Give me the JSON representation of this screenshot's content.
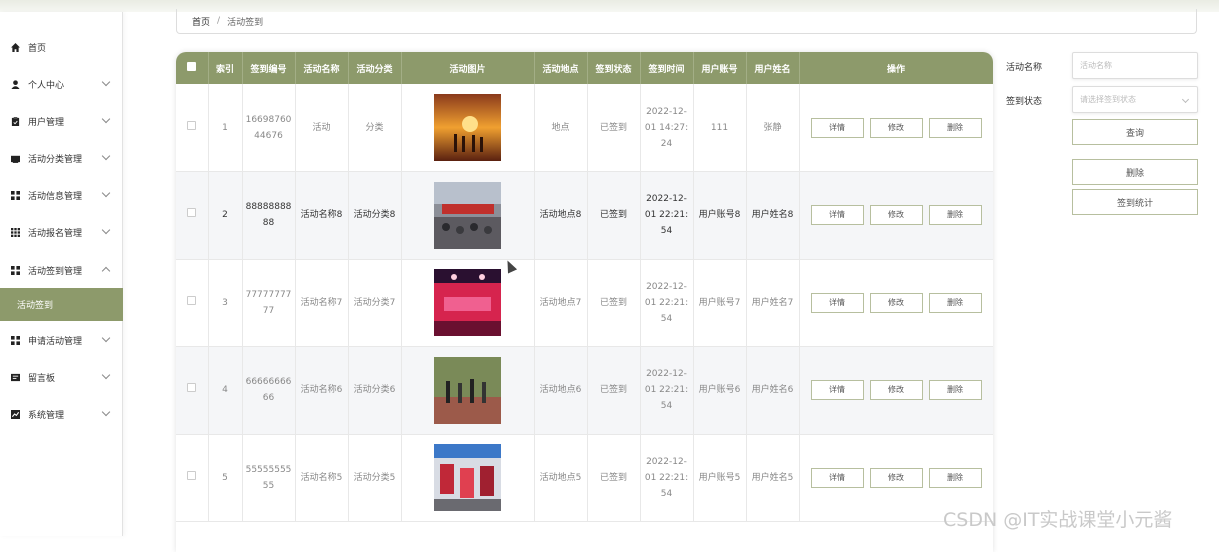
{
  "sidebar": {
    "items": [
      {
        "label": "首页",
        "icon": "home-icon"
      },
      {
        "label": "个人中心",
        "icon": "user-icon"
      },
      {
        "label": "用户管理",
        "icon": "clipboard-icon"
      },
      {
        "label": "活动分类管理",
        "icon": "folder-icon"
      },
      {
        "label": "活动信息管理",
        "icon": "grid-icon"
      },
      {
        "label": "活动报名管理",
        "icon": "grid9-icon"
      },
      {
        "label": "活动签到管理",
        "icon": "grid-icon"
      },
      {
        "label": "活动签到",
        "icon": ""
      },
      {
        "label": "申请活动管理",
        "icon": "grid-icon"
      },
      {
        "label": "留言板",
        "icon": "message-icon"
      },
      {
        "label": "系统管理",
        "icon": "chart-icon"
      }
    ]
  },
  "breadcrumb": {
    "home": "首页",
    "sep": "/",
    "current": "活动签到"
  },
  "table": {
    "headers": [
      "索引",
      "签到编号",
      "活动名称",
      "活动分类",
      "活动图片",
      "活动地点",
      "签到状态",
      "签到时间",
      "用户账号",
      "用户姓名",
      "操作"
    ],
    "actions": {
      "detail": "详情",
      "edit": "修改",
      "delete": "删除"
    },
    "rows": [
      {
        "index": "1",
        "code": "1669876044676",
        "name": "活动",
        "category": "分类",
        "place": "地点",
        "status": "已签到",
        "time": "2022-12-01 14:27:24",
        "account": "111",
        "username": "张静"
      },
      {
        "index": "2",
        "code": "8888888888",
        "name": "活动名称8",
        "category": "活动分类8",
        "place": "活动地点8",
        "status": "已签到",
        "time": "2022-12-01 22:21:54",
        "account": "用户账号8",
        "username": "用户姓名8"
      },
      {
        "index": "3",
        "code": "7777777777",
        "name": "活动名称7",
        "category": "活动分类7",
        "place": "活动地点7",
        "status": "已签到",
        "time": "2022-12-01 22:21:54",
        "account": "用户账号7",
        "username": "用户姓名7"
      },
      {
        "index": "4",
        "code": "6666666666",
        "name": "活动名称6",
        "category": "活动分类6",
        "place": "活动地点6",
        "status": "已签到",
        "time": "2022-12-01 22:21:54",
        "account": "用户账号6",
        "username": "用户姓名6"
      },
      {
        "index": "5",
        "code": "5555555555",
        "name": "活动名称5",
        "category": "活动分类5",
        "place": "活动地点5",
        "status": "已签到",
        "time": "2022-12-01 22:21:54",
        "account": "用户账号5",
        "username": "用户姓名5"
      }
    ]
  },
  "search": {
    "name_label": "活动名称",
    "name_placeholder": "活动名称",
    "status_label": "签到状态",
    "status_placeholder": "请选择签到状态",
    "query_btn": "查询",
    "delete_btn": "删除",
    "stats_btn": "签到统计"
  },
  "watermark": "CSDN @IT实战课堂小元酱",
  "colors": {
    "accent": "#8d9a6b"
  }
}
